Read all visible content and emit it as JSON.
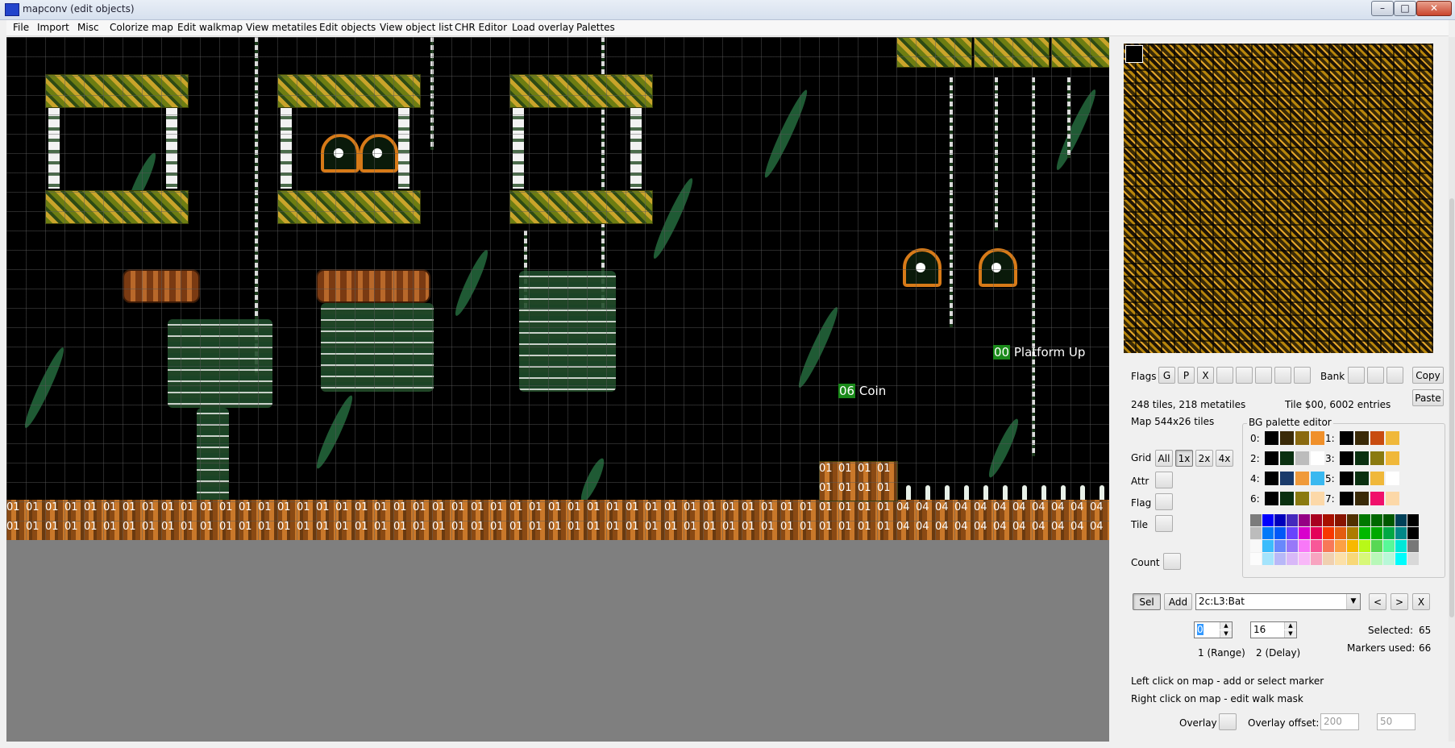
{
  "window": {
    "title": "mapconv (edit objects)",
    "minimize": "–",
    "maximize": "□",
    "close": "✕"
  },
  "menu": [
    "File",
    "Import",
    "Misc",
    "Colorize map",
    "Edit walkmap",
    "View metatiles",
    "Edit objects",
    "View object list",
    "CHR Editor",
    "Load overlay",
    "Palettes"
  ],
  "map": {
    "row_top_ground": [
      "01",
      "01",
      "01",
      "01",
      "01",
      "01",
      "01",
      "01",
      "01",
      "01",
      "01",
      "01",
      "01",
      "01",
      "01",
      "01",
      "01",
      "01",
      "01",
      "01",
      "01",
      "01",
      "01",
      "01",
      "01",
      "01",
      "01",
      "01",
      "01",
      "01",
      "01",
      "01",
      "01",
      "01",
      "01",
      "01",
      "01",
      "01",
      "01",
      "01",
      "01",
      "01",
      "01",
      "01",
      "01",
      "01",
      "04",
      "04",
      "04",
      "04",
      "04",
      "04",
      "04",
      "04",
      "04",
      "04",
      "04"
    ],
    "row_bottom_ground": [
      "01",
      "01",
      "01",
      "01",
      "01",
      "01",
      "01",
      "01",
      "01",
      "01",
      "01",
      "01",
      "01",
      "01",
      "01",
      "01",
      "01",
      "01",
      "01",
      "01",
      "01",
      "01",
      "01",
      "01",
      "01",
      "01",
      "01",
      "01",
      "01",
      "01",
      "01",
      "01",
      "01",
      "01",
      "01",
      "01",
      "01",
      "01",
      "01",
      "01",
      "01",
      "01",
      "01",
      "01",
      "01",
      "01",
      "04",
      "04",
      "04",
      "04",
      "04",
      "04",
      "04",
      "04",
      "04",
      "04",
      "04"
    ],
    "platform_row_1": [
      "01",
      "01",
      "01",
      "01"
    ],
    "platform_row_2": [
      "01",
      "01",
      "01",
      "01"
    ],
    "markers": [
      {
        "id": "00",
        "label": "Platform Up"
      },
      {
        "id": "06",
        "label": "Coin"
      }
    ]
  },
  "panel": {
    "flags_label": "Flags",
    "flag_buttons": [
      "G",
      "P",
      "X",
      "",
      "",
      "",
      "",
      "",
      ""
    ],
    "bank_label": "Bank",
    "copy": "Copy",
    "paste": "Paste",
    "tiles_info": "248 tiles, 218 metatiles",
    "tile_info": "Tile $00, 6002 entries",
    "map_info": "Map 544x26 tiles",
    "grid_label": "Grid",
    "grid_buttons": [
      "All",
      "1x",
      "2x",
      "4x"
    ],
    "attr_label": "Attr",
    "flag_label": "Flag",
    "tile_label": "Tile",
    "count_label": "Count",
    "palette_editor_title": "BG palette editor",
    "palettes": [
      {
        "idx": "0:",
        "colors": [
          "#000000",
          "#3a2a08",
          "#8a6a10",
          "#f0902a"
        ]
      },
      {
        "idx": "1:",
        "colors": [
          "#000000",
          "#3a2a08",
          "#c84c10",
          "#f0b83a"
        ]
      },
      {
        "idx": "2:",
        "colors": [
          "#000000",
          "#0a3010",
          "#bcbcbc",
          "#ffffff"
        ]
      },
      {
        "idx": "3:",
        "colors": [
          "#000000",
          "#0a3010",
          "#8a7a10",
          "#f0b83a"
        ]
      },
      {
        "idx": "4:",
        "colors": [
          "#000000",
          "#1a3a6a",
          "#f09a3a",
          "#3ab8f0"
        ]
      },
      {
        "idx": "5:",
        "colors": [
          "#000000",
          "#0a3010",
          "#f0b83a",
          "#ffffff"
        ]
      },
      {
        "idx": "6:",
        "colors": [
          "#000000",
          "#0a3010",
          "#8a7a10",
          "#fcd8a8"
        ]
      },
      {
        "idx": "7:",
        "colors": [
          "#000000",
          "#3a2a08",
          "#f0106a",
          "#fcd8a8"
        ]
      }
    ],
    "nes_palette": [
      [
        "#7c7c7c",
        "#0000fc",
        "#0000bc",
        "#4428bc",
        "#940084",
        "#a80020",
        "#a81000",
        "#881400",
        "#503000",
        "#007800",
        "#006800",
        "#005800",
        "#004058",
        "#000000"
      ],
      [
        "#bcbcbc",
        "#0078f8",
        "#0058f8",
        "#6844fc",
        "#d800cc",
        "#e40058",
        "#f83800",
        "#e45c10",
        "#ac7c00",
        "#00b800",
        "#00a800",
        "#00a844",
        "#008888",
        "#000000"
      ],
      [
        "#f8f8f8",
        "#3cbcfc",
        "#6888fc",
        "#9878f8",
        "#f878f8",
        "#f85898",
        "#f87858",
        "#fca044",
        "#f8b800",
        "#b8f818",
        "#58d854",
        "#58f898",
        "#00e8d8",
        "#787878"
      ],
      [
        "#fcfcfc",
        "#a4e4fc",
        "#b8b8f8",
        "#d8b8f8",
        "#f8b8f8",
        "#f8a4c0",
        "#f0d0b0",
        "#fce0a8",
        "#f8d878",
        "#d8f878",
        "#b8f8b8",
        "#b8f8d8",
        "#00fcfc",
        "#d8d8d8"
      ]
    ],
    "sel": "Sel",
    "add": "Add",
    "object_select": "2c:L3:Bat",
    "prev": "<",
    "next": ">",
    "delete": "X",
    "range_value": "0",
    "delay_value": "16",
    "range_label": "1 (Range)",
    "delay_label": "2 (Delay)",
    "selected_label": "Selected:",
    "selected_value": "65",
    "markers_used_label": "Markers used:",
    "markers_used_value": "66",
    "help_left": "Left click on map - add or select marker",
    "help_right": "Right click on map - edit walk mask",
    "overlay_label": "Overlay",
    "overlay_offset_label": "Overlay offset:",
    "overlay_x": "200",
    "overlay_y": "50"
  }
}
